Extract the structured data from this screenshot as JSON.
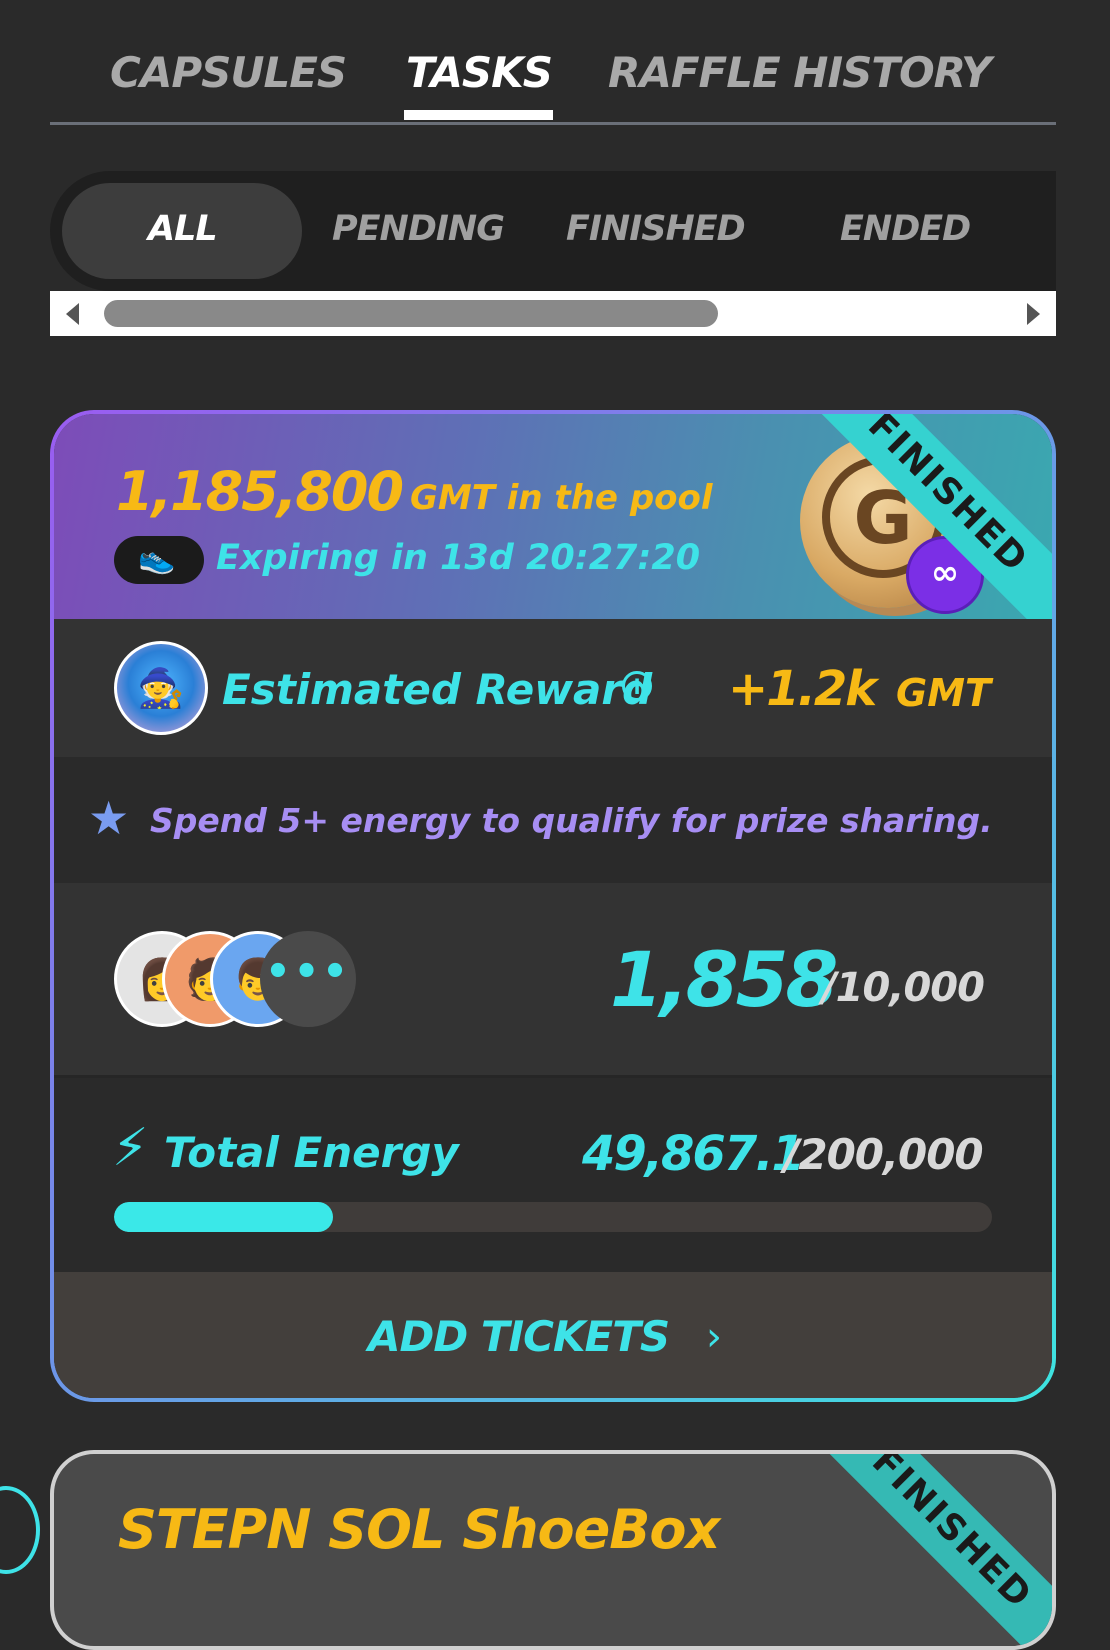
{
  "top_tabs": [
    {
      "label": "CAPSULES",
      "active": false
    },
    {
      "label": "TASKS",
      "active": true
    },
    {
      "label": "RAFFLE HISTORY",
      "active": false
    }
  ],
  "filters": [
    {
      "label": "ALL",
      "active": true
    },
    {
      "label": "PENDING",
      "active": false
    },
    {
      "label": "FINISHED",
      "active": false
    },
    {
      "label": "ENDED",
      "active": false
    }
  ],
  "card": {
    "pool_amount": "1,185,800",
    "pool_label": "GMT in the pool",
    "expiry": "Expiring in 13d 20:27:20",
    "shoe_icon": "running-shoe-icon",
    "coin_glyph": "G",
    "chain_glyph": "∞",
    "status_ribbon": "FINISHED",
    "reward_label": "Estimated Reward",
    "reward_value": "+1.2k",
    "reward_unit": "GMT",
    "qualify_text": "Spend 5+ energy to qualify for prize sharing.",
    "participants_more": "•••",
    "ticket_count": "1,858",
    "ticket_max": "/10,000",
    "energy_label": "Total Energy",
    "energy_value": "49,867.1",
    "energy_max": "/200,000",
    "energy_progress_fraction": 0.249,
    "add_tickets_label": "ADD TICKETS",
    "add_tickets_chevron": "›"
  },
  "card2": {
    "title": "STEPN SOL ShoeBox",
    "status_ribbon": "FINISHED"
  },
  "colors": {
    "accent_cyan": "#3ee3e8",
    "gold": "#f7b915",
    "purple_text": "#a78ef3",
    "background": "#2a2a2a"
  }
}
